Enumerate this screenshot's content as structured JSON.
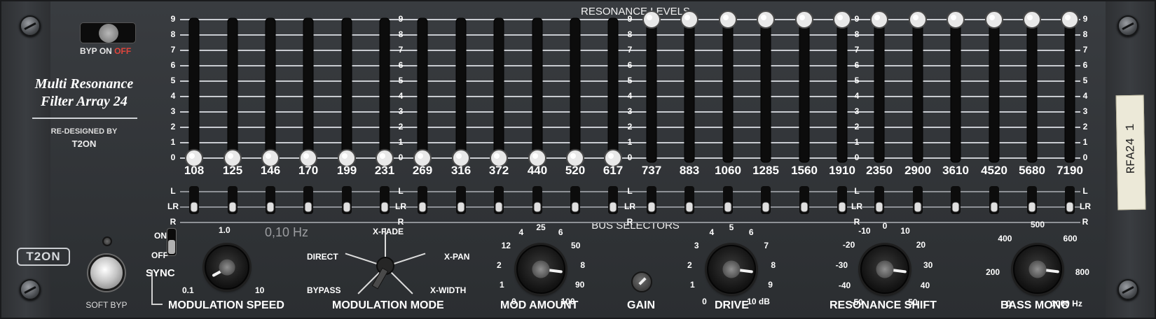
{
  "plugin": {
    "title_line1": "Multi Resonance",
    "title_line2": "Filter Array 24",
    "redesigned_by": "RE-DESIGNED BY",
    "brand": "T2ON",
    "logo": "T2ON",
    "label_tape": "RFA24 1"
  },
  "bypass": {
    "label_byp": "BYP",
    "label_on": "ON",
    "label_off": "OFF",
    "value": "ON"
  },
  "soft_bypass": {
    "label": "SOFT BYP"
  },
  "headers": {
    "resonance": "RESONANCE LEVELS",
    "bus": "BUS SELECTORS"
  },
  "scale": [
    "9",
    "8",
    "7",
    "6",
    "5",
    "4",
    "3",
    "2",
    "1",
    "0"
  ],
  "bus_labels": [
    "L",
    "LR",
    "R"
  ],
  "bands": [
    {
      "freq": "108",
      "level": 0,
      "bus": "LR"
    },
    {
      "freq": "125",
      "level": 0,
      "bus": "LR"
    },
    {
      "freq": "146",
      "level": 0,
      "bus": "LR"
    },
    {
      "freq": "170",
      "level": 0,
      "bus": "LR"
    },
    {
      "freq": "199",
      "level": 0,
      "bus": "LR"
    },
    {
      "freq": "231",
      "level": 0,
      "bus": "LR"
    },
    {
      "freq": "269",
      "level": 0,
      "bus": "LR"
    },
    {
      "freq": "316",
      "level": 0,
      "bus": "LR"
    },
    {
      "freq": "372",
      "level": 0,
      "bus": "LR"
    },
    {
      "freq": "440",
      "level": 0,
      "bus": "LR"
    },
    {
      "freq": "520",
      "level": 0,
      "bus": "LR"
    },
    {
      "freq": "617",
      "level": 0,
      "bus": "LR"
    },
    {
      "freq": "737",
      "level": 9,
      "bus": "LR"
    },
    {
      "freq": "883",
      "level": 9,
      "bus": "LR"
    },
    {
      "freq": "1060",
      "level": 9,
      "bus": "LR"
    },
    {
      "freq": "1285",
      "level": 9,
      "bus": "LR"
    },
    {
      "freq": "1560",
      "level": 9,
      "bus": "LR"
    },
    {
      "freq": "1910",
      "level": 9,
      "bus": "LR"
    },
    {
      "freq": "2350",
      "level": 9,
      "bus": "LR"
    },
    {
      "freq": "2900",
      "level": 9,
      "bus": "LR"
    },
    {
      "freq": "3610",
      "level": 9,
      "bus": "LR"
    },
    {
      "freq": "4520",
      "level": 9,
      "bus": "LR"
    },
    {
      "freq": "5680",
      "level": 9,
      "bus": "LR"
    },
    {
      "freq": "7190",
      "level": 9,
      "bus": "LR"
    }
  ],
  "sync": {
    "on": "ON",
    "off": "OFF",
    "label": "SYNC",
    "value": "OFF"
  },
  "mod_speed": {
    "label": "MODULATION SPEED",
    "readout": "0,10 Hz",
    "ticks": [
      "0.1",
      "1.0",
      "10"
    ],
    "fraction": 0.06
  },
  "mod_mode": {
    "label": "MODULATION MODE",
    "options": [
      "X-FADE",
      "DIRECT",
      "X-PAN",
      "BYPASS",
      "X-WIDTH"
    ],
    "value": "BYPASS"
  },
  "mod_amount": {
    "label": "MOD AMOUNT",
    "ticks": [
      "0",
      "1",
      "2",
      "12",
      "4",
      "25",
      "6",
      "50",
      "8",
      "90",
      "100"
    ],
    "fraction": 0.86
  },
  "gain": {
    "label": "GAIN"
  },
  "drive": {
    "label": "DRIVE",
    "ticks": [
      "0",
      "1",
      "2",
      "3",
      "4",
      "5",
      "6",
      "7",
      "8",
      "9",
      "10 dB"
    ],
    "fraction": 0.86
  },
  "res_shift": {
    "label": "RESONANCE SHIFT",
    "ticks": [
      "-50",
      "-40",
      "-30",
      "-20",
      "-10",
      "0",
      "10",
      "20",
      "30",
      "40",
      "50"
    ],
    "fraction": 0.86
  },
  "bass_mono": {
    "label": "BASS MONO",
    "ticks": [
      "0",
      "200",
      "400",
      "500",
      "600",
      "800",
      "1000 Hz"
    ],
    "fraction": 0.86
  }
}
